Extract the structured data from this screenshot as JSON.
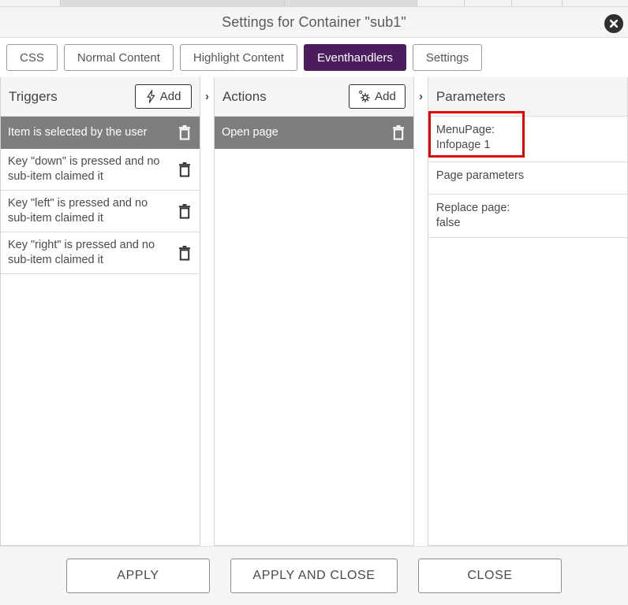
{
  "window": {
    "title": "Settings for Container \"sub1\"",
    "close_icon": "close-circle-icon"
  },
  "tabs": [
    {
      "label": "CSS",
      "active": false
    },
    {
      "label": "Normal Content",
      "active": false
    },
    {
      "label": "Highlight Content",
      "active": false
    },
    {
      "label": "Eventhandlers",
      "active": true
    },
    {
      "label": "Settings",
      "active": false
    }
  ],
  "colors": {
    "active_tab_bg": "#4b1d5e",
    "selected_row_bg": "#7e7e7e",
    "panel_header_bg": "#f5f5f5",
    "highlight_box": "#e60000"
  },
  "chevrons": {
    "triggers_to_actions": "›",
    "actions_to_parameters": "›"
  },
  "triggers": {
    "title": "Triggers",
    "add_label": "Add",
    "add_icon": "lightning-bolt-icon",
    "items": [
      {
        "label": "Item is selected by the user",
        "selected": true
      },
      {
        "label": "Key \"down\" is pressed and no sub-item claimed it",
        "selected": false
      },
      {
        "label": "Key \"left\" is pressed and no sub-item claimed it",
        "selected": false
      },
      {
        "label": "Key \"right\" is pressed and no sub-item claimed it",
        "selected": false
      }
    ]
  },
  "actions": {
    "title": "Actions",
    "add_label": "Add",
    "add_icon": "gear-icon",
    "items": [
      {
        "label": "Open page",
        "selected": true
      }
    ]
  },
  "parameters": {
    "title": "Parameters",
    "items": [
      {
        "label": "MenuPage:\nInfopage 1",
        "highlighted": true
      },
      {
        "label": "Page parameters",
        "highlighted": false
      },
      {
        "label": "Replace page:\nfalse",
        "highlighted": false
      }
    ]
  },
  "footer": {
    "apply": "APPLY",
    "apply_and_close": "APPLY AND CLOSE",
    "close": "CLOSE"
  }
}
